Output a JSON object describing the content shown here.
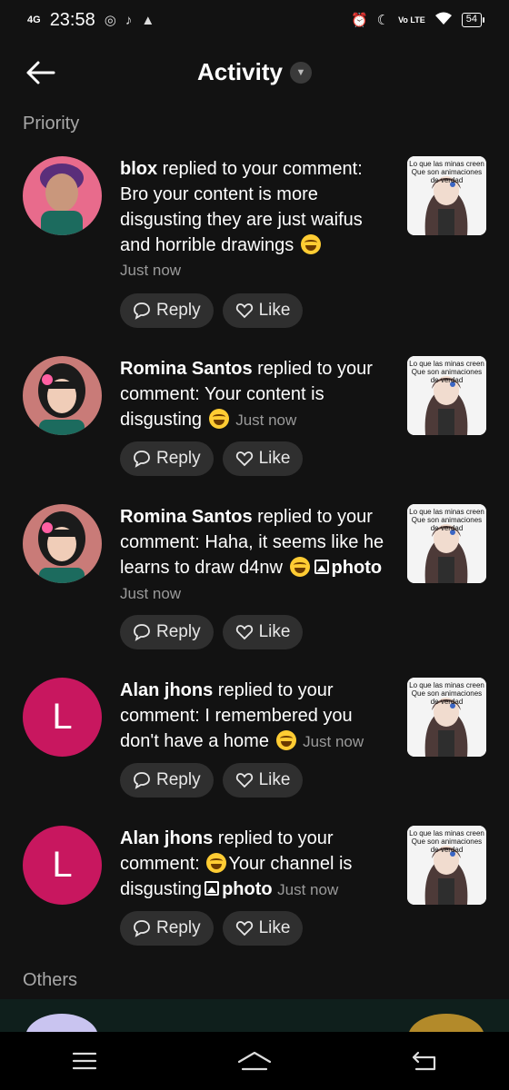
{
  "status_bar": {
    "network": "4G",
    "time": "23:58",
    "battery": "54",
    "volte": "Vo LTE"
  },
  "header": {
    "title": "Activity"
  },
  "sections": {
    "priority": "Priority",
    "others": "Others"
  },
  "actions": {
    "reply": "Reply",
    "like": "Like"
  },
  "notifications": [
    {
      "user": "blox",
      "verb": " replied to your comment: ",
      "text": "Bro your content is more disgusting they are just waifus and horrible drawings",
      "time": "Just now",
      "avatar_letter": ""
    },
    {
      "user": "Romina Santos",
      "verb": " replied to your comment: ",
      "text": "Your content is disgusting",
      "time": "Just now",
      "avatar_letter": ""
    },
    {
      "user": "Romina Santos",
      "verb": " replied to your comment: ",
      "text": "Haha, it seems like he learns to draw d4nw",
      "photo": "photo",
      "time": "Just now",
      "avatar_letter": ""
    },
    {
      "user": "Alan jhons",
      "verb": " replied to your comment: ",
      "text": "I remembered you don't have a home",
      "time": "Just now",
      "avatar_letter": "L"
    },
    {
      "user": "Alan jhons",
      "verb": " replied to your comment: ",
      "text": "Your channel is disgusting",
      "photo": "photo",
      "time": "Just now",
      "avatar_letter": "L"
    }
  ],
  "thumbnail": {
    "caption": "Lo que las minas creen Que son animaciones de verdad"
  },
  "colors": {
    "background": "#121212",
    "pill": "#2f2f2f",
    "avatar_letter_bg": "#c8175f",
    "muted_text": "#9a9a9a"
  }
}
